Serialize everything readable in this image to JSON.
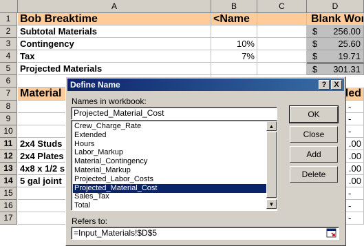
{
  "spreadsheet": {
    "columns": [
      "A",
      "B",
      "C",
      "D"
    ],
    "rows": [
      "1",
      "2",
      "3",
      "4",
      "5",
      "6",
      "7",
      "8",
      "9",
      "10",
      "11",
      "12",
      "13",
      "14",
      "15",
      "16",
      "17"
    ],
    "active_rows": [
      "11",
      "12",
      "13",
      "14"
    ],
    "r1": {
      "a": "Bob Breaktime",
      "b": "<Name",
      "d": "Blank Wor"
    },
    "r2": {
      "a": "Subtotal Materials",
      "d_cur": "$",
      "d_val": "256.00"
    },
    "r3": {
      "a": "Contingency",
      "b": "10%",
      "d_cur": "$",
      "d_val": "25.60"
    },
    "r4": {
      "a": "Tax",
      "b": "7%",
      "d_cur": "$",
      "d_val": "19.71"
    },
    "r5": {
      "a": "Projected Materials",
      "d_cur": "$",
      "d_val": "301.31"
    },
    "r7": {
      "a": "Material",
      "d": "led"
    },
    "r8": {
      "d": "-"
    },
    "r9": {
      "d": "-"
    },
    "r10": {
      "d": "-"
    },
    "r11": {
      "a": "2x4 Studs",
      "d": ".00"
    },
    "r12": {
      "a": "2x4 Plates",
      "d": ".00"
    },
    "r13": {
      "a": "4x8 x 1/2 s",
      "d": ".00"
    },
    "r14": {
      "a": "5 gal joint",
      "d": ".00"
    },
    "r15": {
      "d": "-"
    },
    "r16": {
      "d": "-"
    },
    "r17": {
      "d": "-"
    }
  },
  "dialog": {
    "title": "Define Name",
    "help_button": "?",
    "close_button": "X",
    "names_label": "Names in workbook:",
    "name_value": "Projected_Material_Cost",
    "names": [
      "Crew_Charge_Rate",
      "Extended",
      "Hours",
      "Labor_Markup",
      "Material_Contingency",
      "Material_Markup",
      "Projected_Labor_Costs",
      "Projected_Material_Cost",
      "Sales_Tax",
      "Total"
    ],
    "selected_name": "Projected_Material_Cost",
    "buttons": {
      "ok": "OK",
      "close": "Close",
      "add": "Add",
      "delete": "Delete"
    },
    "refers_label": "Refers to:",
    "refers_value": "=Input_Materials!$D$5"
  },
  "colors": {
    "header_peach": "#ffcc99",
    "selection": "#0a246a",
    "title_gradient_start": "#0a246a"
  }
}
